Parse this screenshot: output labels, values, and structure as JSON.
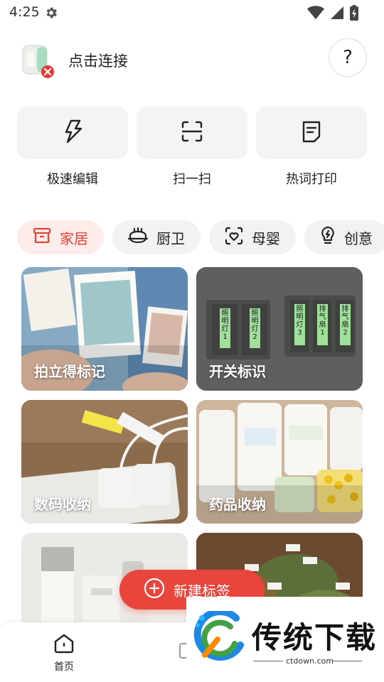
{
  "status_bar": {
    "time": "4:25",
    "icons": [
      "gear-icon",
      "wifi-icon",
      "signal-icon",
      "battery-charging-icon"
    ]
  },
  "device": {
    "label": "点击连接",
    "help": "?",
    "status_icon": "disconnected-badge-icon"
  },
  "features": [
    {
      "label": "极速编辑",
      "icon": "lightning-icon"
    },
    {
      "label": "扫一扫",
      "icon": "scan-icon"
    },
    {
      "label": "热词打印",
      "icon": "note-icon"
    }
  ],
  "categories": [
    {
      "label": "家居",
      "icon": "cabinet-icon",
      "active": true
    },
    {
      "label": "厨卫",
      "icon": "pot-icon",
      "active": false
    },
    {
      "label": "母婴",
      "icon": "baby-heart-icon",
      "active": false
    },
    {
      "label": "创意",
      "icon": "bulb-icon",
      "active": false
    }
  ],
  "cards": [
    {
      "title": "拍立得标记"
    },
    {
      "title": "开关标识",
      "switch_labels": [
        "照明灯1",
        "照明灯2",
        "照明灯3",
        "排气扇1",
        "排气扇2"
      ]
    },
    {
      "title": "数码收纳"
    },
    {
      "title": "药品收纳"
    },
    {
      "title": ""
    },
    {
      "title": ""
    }
  ],
  "fab": {
    "label": "新建标签"
  },
  "bottom_nav": {
    "home_label": "首页"
  },
  "watermark": {
    "text": "传统下载",
    "url": "ctdown.com"
  },
  "colors": {
    "accent": "#e8453c",
    "chip_bg": "#f2f2f2",
    "card_bg": "#f3f4f6"
  }
}
